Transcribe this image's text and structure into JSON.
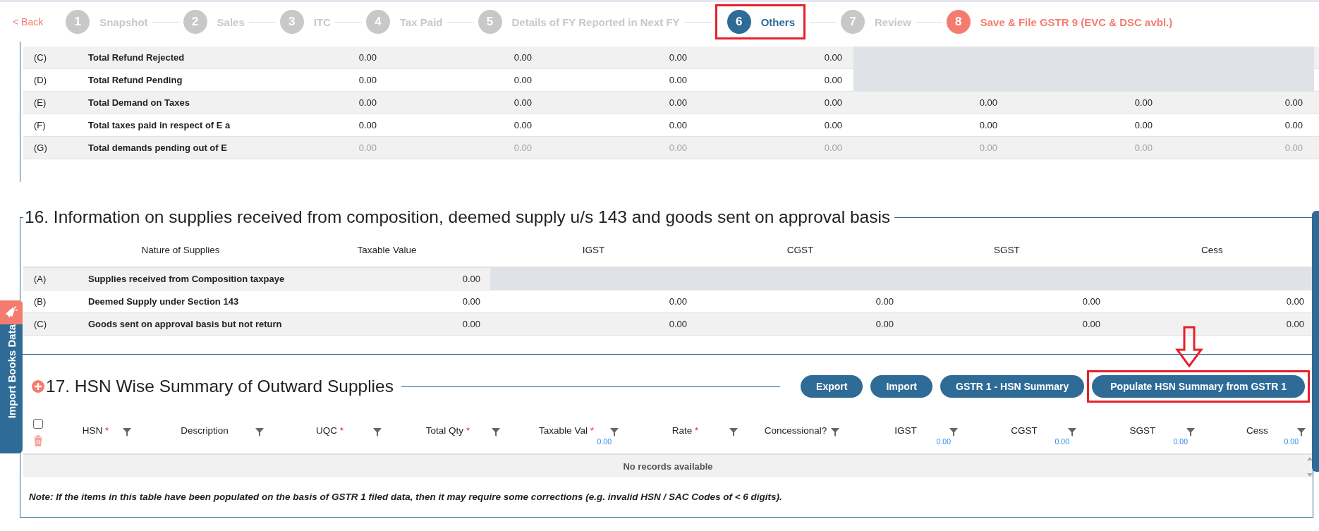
{
  "stepper": {
    "back": "< Back",
    "steps": [
      {
        "number": "1",
        "label": "Snapshot",
        "kind": "step",
        "selected": false,
        "boxed": false
      },
      {
        "number": "2",
        "label": "Sales",
        "kind": "step",
        "selected": false,
        "boxed": false
      },
      {
        "number": "3",
        "label": "ITC",
        "kind": "step",
        "selected": false,
        "boxed": false
      },
      {
        "number": "4",
        "label": "Tax Paid",
        "kind": "step",
        "selected": false,
        "boxed": false
      },
      {
        "number": "5",
        "label": "Details of FY Reported in Next FY",
        "kind": "step",
        "selected": false,
        "boxed": false
      },
      {
        "number": "6",
        "label": "Others",
        "kind": "step",
        "selected": true,
        "boxed": true
      },
      {
        "number": "7",
        "label": "Review",
        "kind": "step",
        "selected": false,
        "boxed": false
      },
      {
        "number": "8",
        "label": "Save & File GSTR 9 (EVC & DSC avbl.)",
        "kind": "submit",
        "selected": false,
        "boxed": false
      }
    ]
  },
  "section_15": {
    "rows": [
      {
        "code": "(C)",
        "description": "Total Refund Rejected",
        "kind": "partial",
        "disabled": false,
        "values": [
          "0.00",
          "0.00",
          "0.00",
          "0.00"
        ]
      },
      {
        "code": "(D)",
        "description": "Total Refund Pending",
        "kind": "partial",
        "disabled": false,
        "values": [
          "0.00",
          "0.00",
          "0.00",
          "0.00"
        ]
      },
      {
        "code": "(E)",
        "description": "Total Demand on Taxes",
        "kind": "full",
        "disabled": false,
        "values": [
          "0.00",
          "0.00",
          "0.00",
          "0.00",
          "0.00",
          "0.00",
          "0.00"
        ]
      },
      {
        "code": "(F)",
        "description": "Total taxes paid in respect of E a",
        "kind": "full",
        "disabled": false,
        "values": [
          "0.00",
          "0.00",
          "0.00",
          "0.00",
          "0.00",
          "0.00",
          "0.00"
        ]
      },
      {
        "code": "(G)",
        "description": "Total demands pending out of E",
        "kind": "full",
        "disabled": true,
        "values": [
          "0.00",
          "0.00",
          "0.00",
          "0.00",
          "0.00",
          "0.00",
          "0.00"
        ]
      }
    ]
  },
  "section_16": {
    "title": "16. Information on supplies received from composition, deemed supply u/s 143 and goods sent on approval basis",
    "columns": [
      "Nature of Supplies",
      "Taxable Value",
      "IGST",
      "CGST",
      "SGST",
      "Cess"
    ],
    "rows": [
      {
        "code": "(A)",
        "description": "Supplies received from Composition taxpaye",
        "kind": "partial",
        "values": [
          "0.00"
        ]
      },
      {
        "code": "(B)",
        "description": "Deemed Supply under Section 143",
        "kind": "full",
        "values": [
          "0.00",
          "0.00",
          "0.00",
          "0.00",
          "0.00"
        ]
      },
      {
        "code": "(C)",
        "description": "Goods sent on approval basis but not return",
        "kind": "full",
        "values": [
          "0.00",
          "0.00",
          "0.00",
          "0.00",
          "0.00"
        ]
      }
    ]
  },
  "section_17": {
    "title": "17. HSN Wise Summary of Outward Supplies",
    "buttons": [
      {
        "label": "Export",
        "boxed": false,
        "arrow": false
      },
      {
        "label": "Import",
        "boxed": false,
        "arrow": false
      },
      {
        "label": "GSTR 1 - HSN Summary",
        "boxed": false,
        "arrow": false
      },
      {
        "label": "Populate HSN Summary from GSTR 1",
        "boxed": true,
        "arrow": true
      }
    ],
    "select_all": {
      "checked": false
    },
    "columns": [
      {
        "label": "HSN",
        "marker": "*"
      },
      {
        "label": "Description"
      },
      {
        "label": "UQC",
        "marker": "*"
      },
      {
        "label": "Total Qty",
        "marker": "*"
      },
      {
        "label": "Taxable Val",
        "marker": "*",
        "total": "0.00"
      },
      {
        "label": "Rate",
        "marker": "*"
      },
      {
        "label": "Concessional?"
      },
      {
        "label": "IGST",
        "total": "0.00"
      },
      {
        "label": "CGST",
        "total": "0.00"
      },
      {
        "label": "SGST",
        "total": "0.00"
      },
      {
        "label": "Cess",
        "total": "0.00"
      }
    ],
    "empty_message": "No records available",
    "note": "Note: If the items in this table have been populated on the basis of GSTR 1 filed data, then it may require some corrections (e.g. invalid HSN / SAC Codes of < 6 digits)."
  },
  "side_tab": {
    "label": "Import Books Data"
  }
}
